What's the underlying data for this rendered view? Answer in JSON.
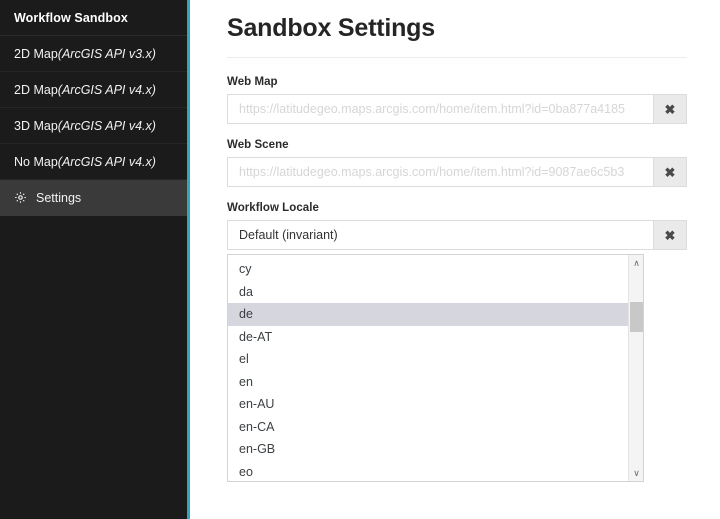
{
  "sidebar": {
    "title": "Workflow Sandbox",
    "items": [
      {
        "name": "2d-map-v3",
        "prefix": "2D Map ",
        "api": "(ArcGIS API v3.x)",
        "icon": null,
        "active": false
      },
      {
        "name": "2d-map-v4",
        "prefix": "2D Map ",
        "api": "(ArcGIS API v4.x)",
        "icon": null,
        "active": false
      },
      {
        "name": "3d-map-v4",
        "prefix": "3D Map ",
        "api": "(ArcGIS API v4.x)",
        "icon": null,
        "active": false
      },
      {
        "name": "no-map-v4",
        "prefix": "No Map ",
        "api": "(ArcGIS API v4.x)",
        "icon": null,
        "active": false
      },
      {
        "name": "settings",
        "prefix": "Settings",
        "api": "",
        "icon": "gear-icon",
        "active": true
      }
    ],
    "accent_color": "#2fa8b8",
    "background_color": "#1b1b1b",
    "active_background_color": "#3a3a3a"
  },
  "main": {
    "page_title": "Sandbox Settings",
    "fields": [
      {
        "name": "web-map",
        "label": "Web Map",
        "value": "",
        "placeholder": "https://latitudegeo.maps.arcgis.com/home/item.html?id=0ba877a4185",
        "clear_label": "✖"
      },
      {
        "name": "web-scene",
        "label": "Web Scene",
        "value": "",
        "placeholder": "https://latitudegeo.maps.arcgis.com/home/item.html?id=9087ae6c5b3",
        "clear_label": "✖"
      },
      {
        "name": "workflow-locale",
        "label": "Workflow Locale",
        "value": "Default (invariant)",
        "placeholder": "",
        "clear_label": "✖"
      }
    ],
    "locale_dropdown": {
      "open": true,
      "selected": "de",
      "options": [
        "cy",
        "da",
        "de",
        "de-AT",
        "el",
        "en",
        "en-AU",
        "en-CA",
        "en-GB",
        "eo"
      ],
      "scroll_up_label": "∧",
      "scroll_down_label": "∨",
      "highlight_color": "#d6d6de"
    }
  }
}
